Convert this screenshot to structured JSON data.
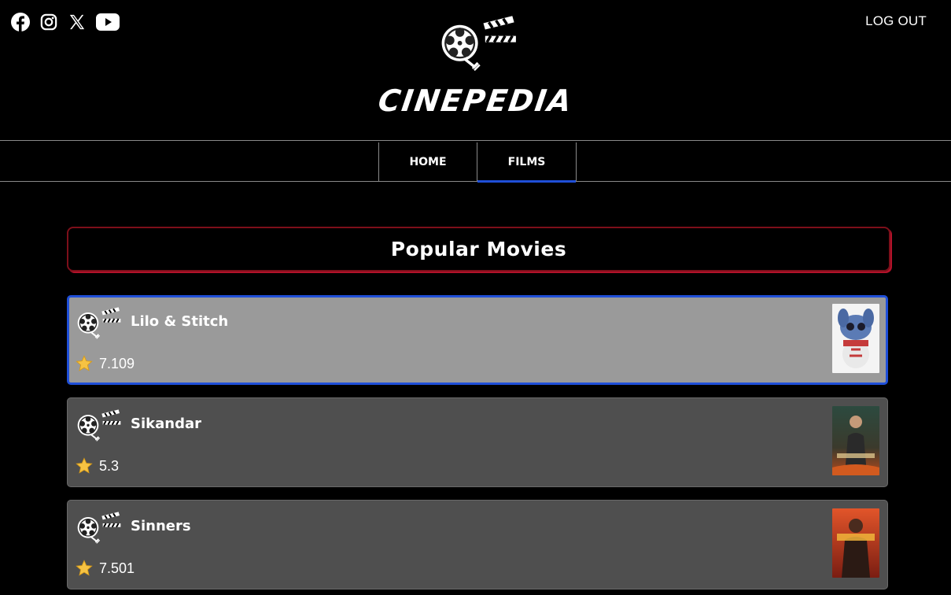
{
  "header": {
    "brand": "CINEPEDIA",
    "logout_label": "LOG OUT",
    "social_icons": [
      "facebook-icon",
      "instagram-icon",
      "x-icon",
      "youtube-icon"
    ]
  },
  "nav": {
    "tabs": [
      {
        "label": "HOME",
        "active": false
      },
      {
        "label": "FILMS",
        "active": true
      }
    ]
  },
  "main": {
    "section_title": "Popular Movies",
    "movies": [
      {
        "title": "Lilo & Stitch",
        "rating": "7.109",
        "selected": true
      },
      {
        "title": "Sikandar",
        "rating": "5.3",
        "selected": false
      },
      {
        "title": "Sinners",
        "rating": "7.501",
        "selected": false
      }
    ]
  },
  "colors": {
    "background": "#000000",
    "accent_blue": "#1f4fd8",
    "accent_red": "#b3122a",
    "card_gray": "#4f4f4f",
    "card_selected": "#9a9a9a"
  }
}
